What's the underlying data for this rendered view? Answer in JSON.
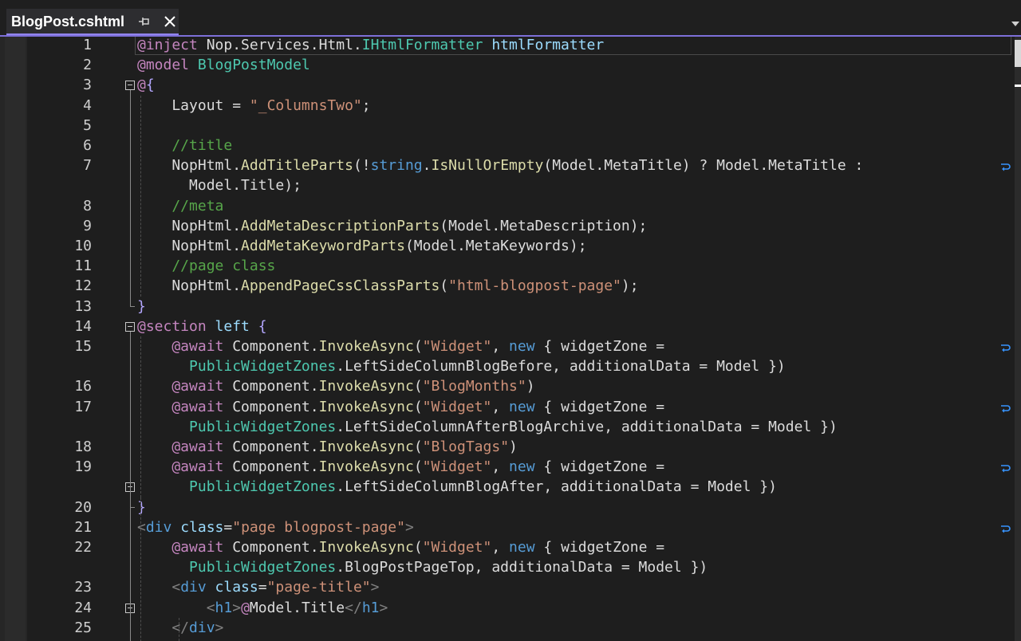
{
  "tab": {
    "title": "BlogPost.cshtml",
    "pin_icon": "pin-icon",
    "close_icon": "close-icon",
    "dropdown_icon": "chevron-down-icon"
  },
  "colors": {
    "background": "#1e1e1e",
    "accent": "#7d6fd8",
    "keyword": "#569cd6",
    "razor": "#c586c0",
    "type": "#4ec9b0",
    "method": "#dcdcaa",
    "string": "#ce9178",
    "comment": "#57a64a"
  },
  "lines": [
    {
      "num": "1",
      "segs": [
        [
          "r",
          "@inject"
        ],
        [
          "p",
          " Nop.Services.Html."
        ],
        [
          "t",
          "IHtmlFormatter"
        ],
        [
          "p",
          " "
        ],
        [
          "a",
          "htmlFormatter"
        ]
      ]
    },
    {
      "num": "2",
      "segs": [
        [
          "r",
          "@model"
        ],
        [
          "p",
          " "
        ],
        [
          "t",
          "BlogPostModel"
        ]
      ]
    },
    {
      "num": "3",
      "segs": [
        [
          "r",
          "@"
        ],
        [
          "br",
          "{"
        ]
      ]
    },
    {
      "num": "4",
      "segs": [
        [
          "p",
          "    Layout = "
        ],
        [
          "s",
          "\"_ColumnsTwo\""
        ],
        [
          "p",
          ";"
        ]
      ]
    },
    {
      "num": "5",
      "segs": [
        [
          "p",
          ""
        ]
      ]
    },
    {
      "num": "6",
      "segs": [
        [
          "c",
          "    //title"
        ]
      ]
    },
    {
      "num": "7",
      "segs": [
        [
          "p",
          "    NopHtml."
        ],
        [
          "m",
          "AddTitleParts"
        ],
        [
          "p",
          "(!"
        ],
        [
          "k",
          "string"
        ],
        [
          "p",
          "."
        ],
        [
          "m",
          "IsNullOrEmpty"
        ],
        [
          "p",
          "(Model.MetaTitle) ? Model.MetaTitle :"
        ]
      ]
    },
    {
      "num": "",
      "segs": [
        [
          "p",
          "      Model.Title);"
        ]
      ]
    },
    {
      "num": "8",
      "segs": [
        [
          "c",
          "    //meta"
        ]
      ]
    },
    {
      "num": "9",
      "segs": [
        [
          "p",
          "    NopHtml."
        ],
        [
          "m",
          "AddMetaDescriptionParts"
        ],
        [
          "p",
          "(Model.MetaDescription);"
        ]
      ]
    },
    {
      "num": "10",
      "segs": [
        [
          "p",
          "    NopHtml."
        ],
        [
          "m",
          "AddMetaKeywordParts"
        ],
        [
          "p",
          "(Model.MetaKeywords);"
        ]
      ]
    },
    {
      "num": "11",
      "segs": [
        [
          "c",
          "    //page class"
        ]
      ]
    },
    {
      "num": "12",
      "segs": [
        [
          "p",
          "    NopHtml."
        ],
        [
          "m",
          "AppendPageCssClassParts"
        ],
        [
          "p",
          "("
        ],
        [
          "s",
          "\"html-blogpost-page\""
        ],
        [
          "p",
          ");"
        ]
      ]
    },
    {
      "num": "13",
      "segs": [
        [
          "br",
          "}"
        ]
      ]
    },
    {
      "num": "14",
      "segs": [
        [
          "r",
          "@section"
        ],
        [
          "p",
          " "
        ],
        [
          "a",
          "left"
        ],
        [
          "p",
          " "
        ],
        [
          "br",
          "{"
        ]
      ]
    },
    {
      "num": "15",
      "segs": [
        [
          "r",
          "    @await"
        ],
        [
          "p",
          " Component."
        ],
        [
          "m",
          "InvokeAsync"
        ],
        [
          "p",
          "("
        ],
        [
          "s",
          "\"Widget\""
        ],
        [
          "p",
          ", "
        ],
        [
          "k",
          "new"
        ],
        [
          "p",
          " { widgetZone ="
        ]
      ]
    },
    {
      "num": "",
      "segs": [
        [
          "t",
          "      PublicWidgetZones"
        ],
        [
          "p",
          ".LeftSideColumnBlogBefore, additionalData = Model })"
        ]
      ]
    },
    {
      "num": "16",
      "segs": [
        [
          "r",
          "    @await"
        ],
        [
          "p",
          " Component."
        ],
        [
          "m",
          "InvokeAsync"
        ],
        [
          "p",
          "("
        ],
        [
          "s",
          "\"BlogMonths\""
        ],
        [
          "p",
          ")"
        ]
      ]
    },
    {
      "num": "17",
      "segs": [
        [
          "r",
          "    @await"
        ],
        [
          "p",
          " Component."
        ],
        [
          "m",
          "InvokeAsync"
        ],
        [
          "p",
          "("
        ],
        [
          "s",
          "\"Widget\""
        ],
        [
          "p",
          ", "
        ],
        [
          "k",
          "new"
        ],
        [
          "p",
          " { widgetZone ="
        ]
      ]
    },
    {
      "num": "",
      "segs": [
        [
          "t",
          "      PublicWidgetZones"
        ],
        [
          "p",
          ".LeftSideColumnAfterBlogArchive, additionalData = Model })"
        ]
      ]
    },
    {
      "num": "18",
      "segs": [
        [
          "r",
          "    @await"
        ],
        [
          "p",
          " Component."
        ],
        [
          "m",
          "InvokeAsync"
        ],
        [
          "p",
          "("
        ],
        [
          "s",
          "\"BlogTags\""
        ],
        [
          "p",
          ")"
        ]
      ]
    },
    {
      "num": "19",
      "segs": [
        [
          "r",
          "    @await"
        ],
        [
          "p",
          " Component."
        ],
        [
          "m",
          "InvokeAsync"
        ],
        [
          "p",
          "("
        ],
        [
          "s",
          "\"Widget\""
        ],
        [
          "p",
          ", "
        ],
        [
          "k",
          "new"
        ],
        [
          "p",
          " { widgetZone ="
        ]
      ]
    },
    {
      "num": "",
      "segs": [
        [
          "t",
          "      PublicWidgetZones"
        ],
        [
          "p",
          ".LeftSideColumnBlogAfter, additionalData = Model })"
        ]
      ]
    },
    {
      "num": "20",
      "segs": [
        [
          "br",
          "}"
        ]
      ]
    },
    {
      "num": "21",
      "segs": [
        [
          "tg",
          "<"
        ],
        [
          "hn",
          "div"
        ],
        [
          "p",
          " "
        ],
        [
          "a",
          "class"
        ],
        [
          "p",
          "="
        ],
        [
          "s",
          "\"page blogpost-page\""
        ],
        [
          "tg",
          ">"
        ]
      ]
    },
    {
      "num": "22",
      "segs": [
        [
          "r",
          "    @await"
        ],
        [
          "p",
          " Component."
        ],
        [
          "m",
          "InvokeAsync"
        ],
        [
          "p",
          "("
        ],
        [
          "s",
          "\"Widget\""
        ],
        [
          "p",
          ", "
        ],
        [
          "k",
          "new"
        ],
        [
          "p",
          " { widgetZone ="
        ]
      ]
    },
    {
      "num": "",
      "segs": [
        [
          "t",
          "      PublicWidgetZones"
        ],
        [
          "p",
          ".BlogPostPageTop, additionalData = Model })"
        ]
      ]
    },
    {
      "num": "23",
      "segs": [
        [
          "tg",
          "    <"
        ],
        [
          "hn",
          "div"
        ],
        [
          "p",
          " "
        ],
        [
          "a",
          "class"
        ],
        [
          "p",
          "="
        ],
        [
          "s",
          "\"page-title\""
        ],
        [
          "tg",
          ">"
        ]
      ]
    },
    {
      "num": "24",
      "segs": [
        [
          "tg",
          "        <"
        ],
        [
          "hn",
          "h1"
        ],
        [
          "tg",
          ">"
        ],
        [
          "r",
          "@"
        ],
        [
          "p",
          "Model.Title"
        ],
        [
          "tg",
          "</"
        ],
        [
          "hn",
          "h1"
        ],
        [
          "tg",
          ">"
        ]
      ]
    },
    {
      "num": "25",
      "segs": [
        [
          "tg",
          "    </"
        ],
        [
          "hn",
          "div"
        ],
        [
          "tg",
          ">"
        ]
      ]
    }
  ]
}
